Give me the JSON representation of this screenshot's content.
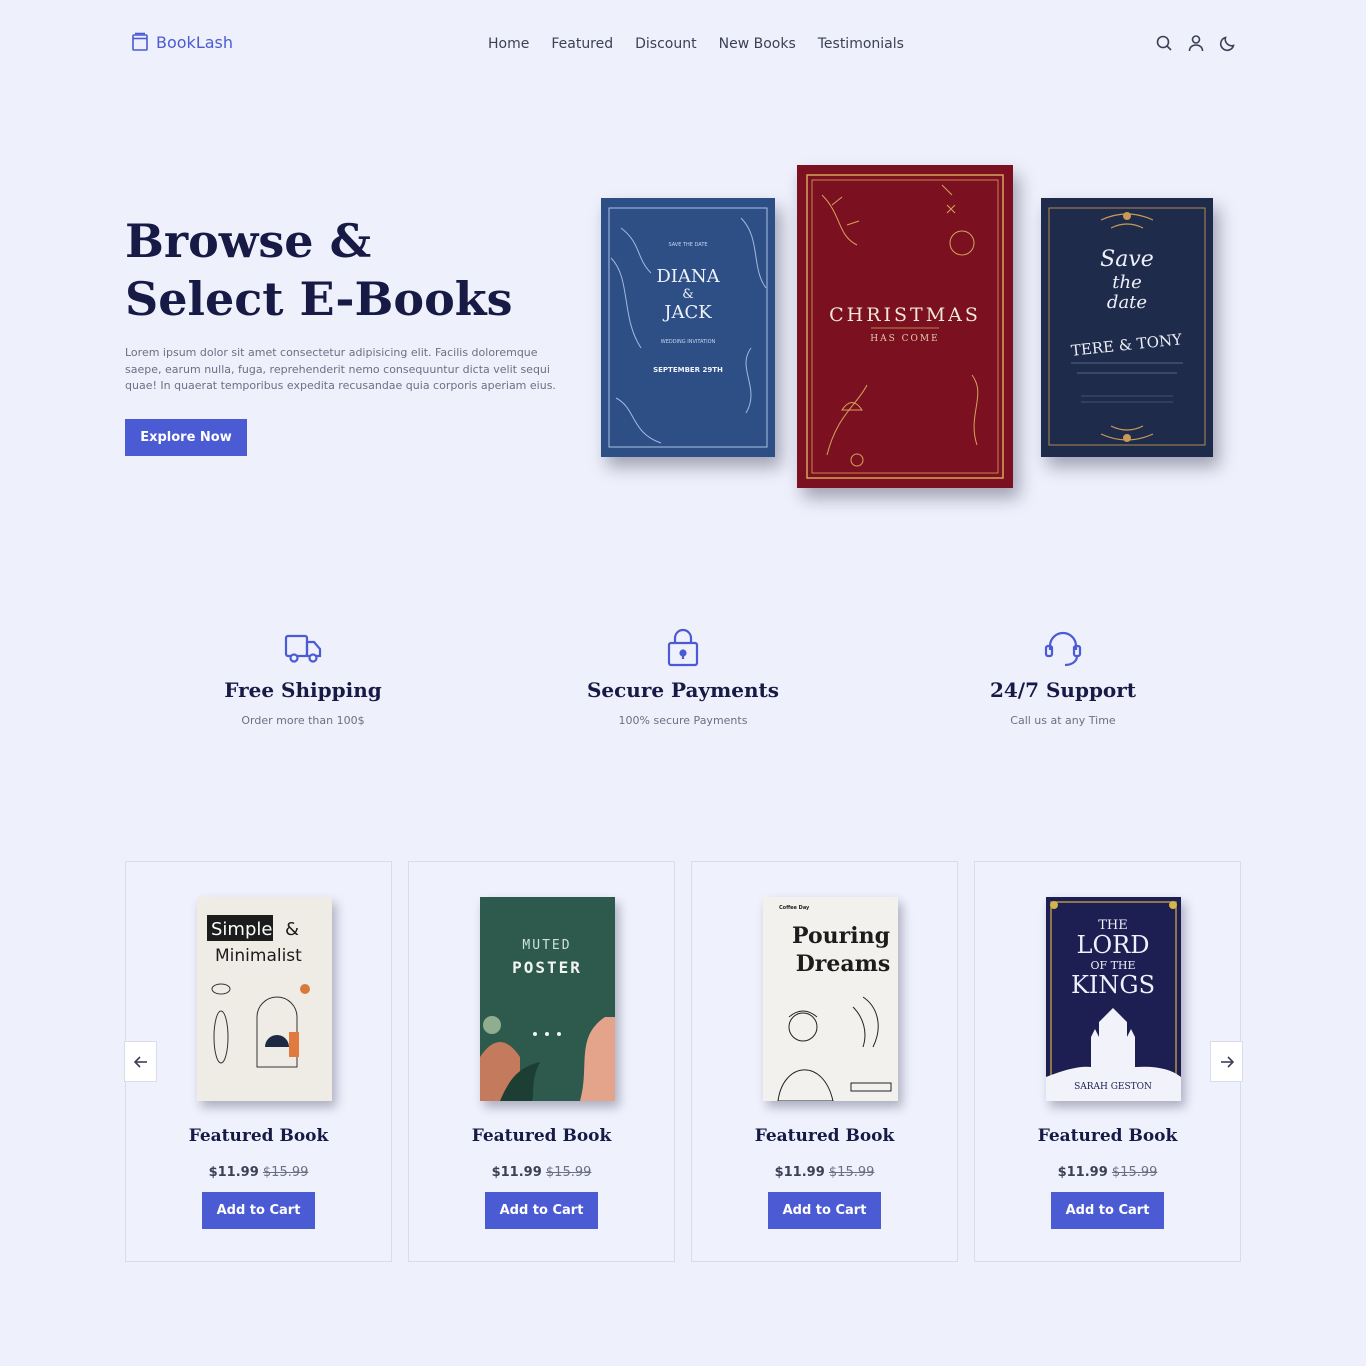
{
  "brand": {
    "name": "BookLash",
    "accent": "#4b5bd3"
  },
  "nav": [
    "Home",
    "Featured",
    "Discount",
    "New Books",
    "Testimonials"
  ],
  "header_icons": [
    "search-icon",
    "user-icon",
    "moon-icon"
  ],
  "hero": {
    "title_line1": "Browse &",
    "title_line2": "Select E-Books",
    "text": "Lorem ipsum dolor sit amet consectetur adipisicing elit. Facilis doloremque saepe, earum nulla, fuga, reprehenderit nemo consequuntur dicta velit sequi quae! In quaerat temporibus expedita recusandae quia corporis aperiam eius.",
    "button": "Explore Now",
    "covers": [
      {
        "line1": "DIANA",
        "line2": "&",
        "line3": "JACK",
        "small1": "SAVE THE DATE",
        "small2": "WEDDING INVITATION",
        "small3": "SEPTEMBER 29TH"
      },
      {
        "line1": "CHRISTMAS",
        "line2": "HAS COME"
      },
      {
        "line1": "Save",
        "line2": "the",
        "line3": "date",
        "line4": "TERE & TONY"
      }
    ]
  },
  "features": [
    {
      "icon": "truck-icon",
      "title": "Free Shipping",
      "text": "Order more than 100$"
    },
    {
      "icon": "lock-icon",
      "title": "Secure Payments",
      "text": "100% secure Payments"
    },
    {
      "icon": "headset-icon",
      "title": "24/7 Support",
      "text": "Call us at any Time"
    }
  ],
  "products": [
    {
      "title": "Featured Book",
      "price": "$11.99",
      "old_price": "$15.99",
      "button": "Add to Cart",
      "cover": {
        "line1": "Simple",
        "line2": "&",
        "line3": "Minimalist"
      }
    },
    {
      "title": "Featured Book",
      "price": "$11.99",
      "old_price": "$15.99",
      "button": "Add to Cart",
      "cover": {
        "line1": "MUTED",
        "line2": "POSTER"
      }
    },
    {
      "title": "Featured Book",
      "price": "$11.99",
      "old_price": "$15.99",
      "button": "Add to Cart",
      "cover": {
        "line1": "Pouring",
        "line2": "Dreams",
        "line3": "Coffee Day"
      }
    },
    {
      "title": "Featured Book",
      "price": "$11.99",
      "old_price": "$15.99",
      "button": "Add to Cart",
      "cover": {
        "line1": "THE",
        "line2": "LORD",
        "line3": "OF THE",
        "line4": "KINGS",
        "author": "SARAH GESTON"
      }
    }
  ],
  "carousel": {
    "prev_icon": "arrow-left-icon",
    "next_icon": "arrow-right-icon"
  }
}
